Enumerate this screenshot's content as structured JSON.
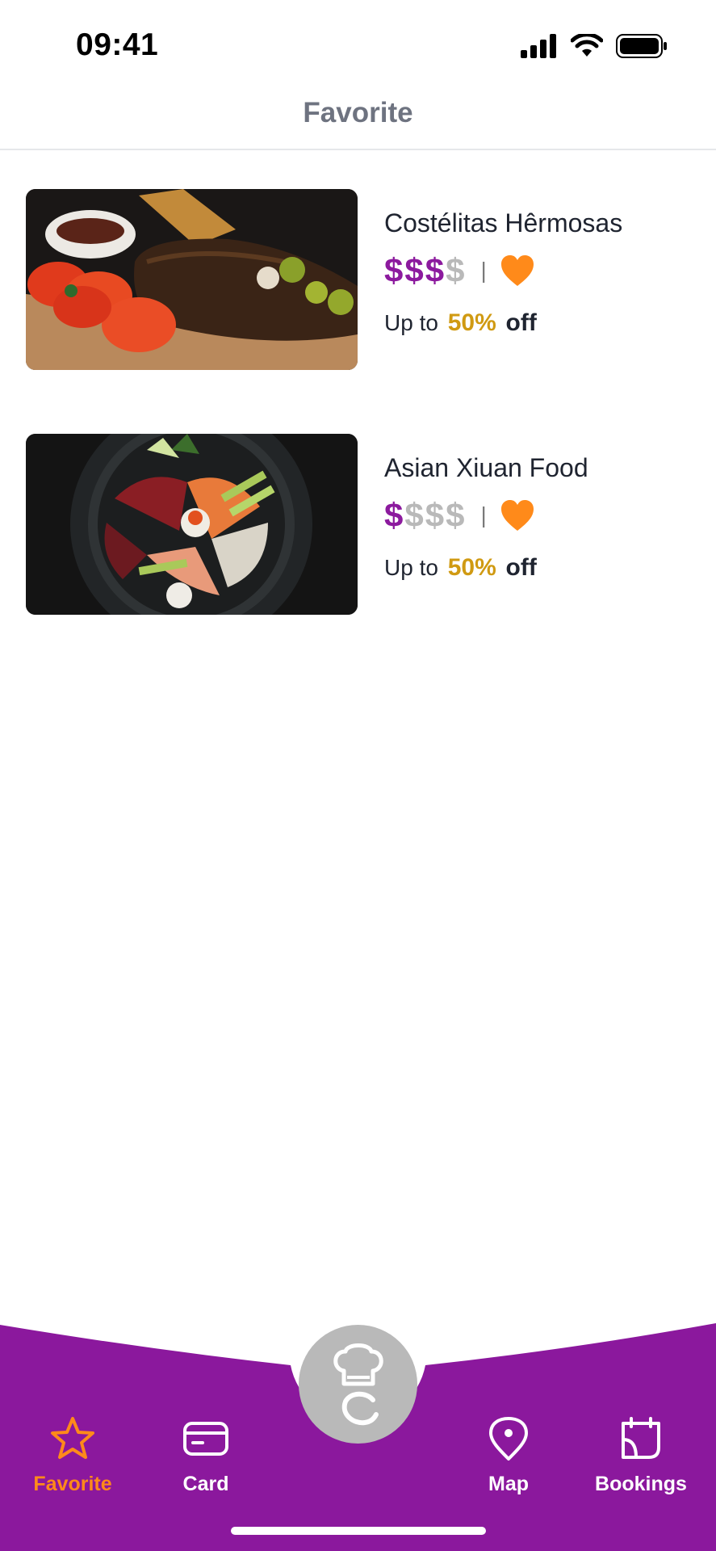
{
  "status_bar": {
    "time": "09:41"
  },
  "header": {
    "title": "Favorite"
  },
  "favorites": [
    {
      "name": "Costélitas Hêrmosas",
      "price_level": 3,
      "price_max": 4,
      "favorited": true,
      "discount_prefix": "Up to",
      "discount_value": "50%",
      "discount_suffix": "off"
    },
    {
      "name": "Asian Xiuan Food",
      "price_level": 1,
      "price_max": 4,
      "favorited": true,
      "discount_prefix": "Up to",
      "discount_value": "50%",
      "discount_suffix": "off"
    }
  ],
  "price_separator": "|",
  "price_symbol": "$",
  "tabbar": {
    "tabs": [
      {
        "label": "Favorite",
        "icon": "star-icon",
        "active": true
      },
      {
        "label": "Card",
        "icon": "card-icon",
        "active": false
      },
      {
        "label": "Map",
        "icon": "map-pin-icon",
        "active": false
      },
      {
        "label": "Bookings",
        "icon": "bookings-icon",
        "active": false
      }
    ],
    "center_icon": "chef-hat-icon"
  },
  "colors": {
    "brand_purple": "#8b189d",
    "accent_orange": "#ff8a1a",
    "discount_gold": "#d09a12",
    "inactive_gray": "#b9b9b9"
  }
}
